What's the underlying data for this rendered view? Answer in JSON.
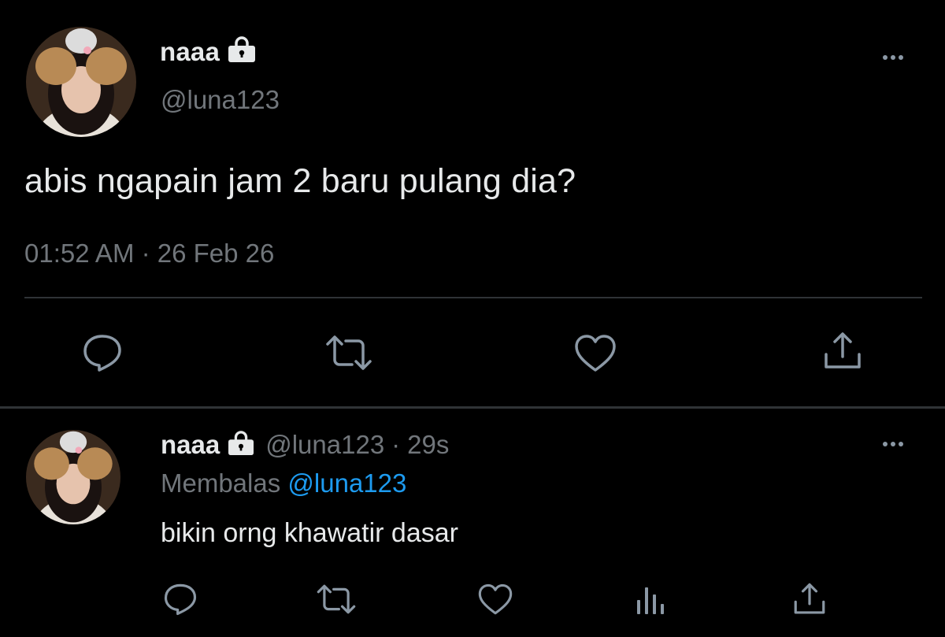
{
  "main_tweet": {
    "display_name": "naaa",
    "handle": "@luna123",
    "text": "abis ngapain jam 2 baru pulang dia?",
    "timestamp": "01:52 AM · 26 Feb 26",
    "icons": [
      "lock-icon",
      "more-icon",
      "reply-icon",
      "retweet-icon",
      "like-icon",
      "share-icon"
    ]
  },
  "reply_tweet": {
    "display_name": "naaa",
    "handle": "@luna123",
    "separator": "·",
    "time_ago": "29s",
    "replying_label": "Membalas",
    "replying_to": "@luna123",
    "text": "bikin orng khawatir dasar",
    "icons": [
      "lock-icon",
      "more-icon",
      "reply-icon",
      "retweet-icon",
      "like-icon",
      "views-icon",
      "share-icon"
    ]
  },
  "colors": {
    "background": "#000000",
    "primary_text": "#e7e9ea",
    "secondary_text": "#71767b",
    "icon": "#8b98a5",
    "link": "#1d9bf0",
    "divider": "#2f3336"
  }
}
